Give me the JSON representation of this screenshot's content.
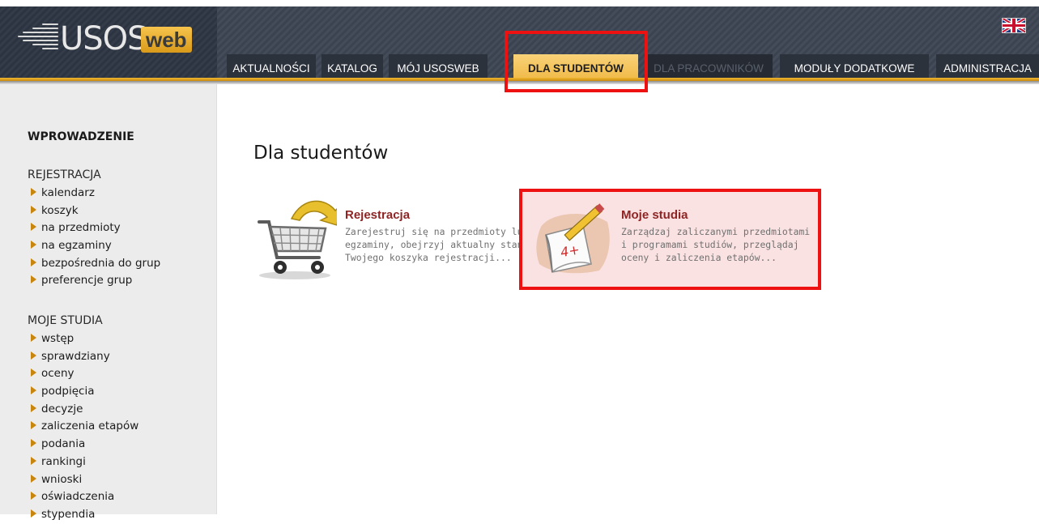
{
  "logo": {
    "main": "USOS",
    "accent": "web"
  },
  "nav": {
    "tabs": [
      {
        "label": "AKTUALNOŚCI"
      },
      {
        "label": "KATALOG"
      },
      {
        "label": "MÓJ USOSWEB"
      },
      {
        "label": "DLA STUDENTÓW",
        "active": true
      },
      {
        "label": "DLA PRACOWNIKÓW",
        "disabled": true
      },
      {
        "label": "MODUŁY DODATKOWE"
      },
      {
        "label": "ADMINISTRACJA"
      }
    ]
  },
  "language_flag": "uk-flag-icon",
  "sidebar": {
    "intro": "WPROWADZENIE",
    "sections": [
      {
        "heading": "REJESTRACJA",
        "items": [
          "kalendarz",
          "koszyk",
          "na przedmioty",
          "na egzaminy",
          "bezpośrednia do grup",
          "preferencje grup"
        ]
      },
      {
        "heading": "MOJE STUDIA",
        "items": [
          "wstęp",
          "sprawdziany",
          "oceny",
          "podpięcia",
          "decyzje",
          "zaliczenia etapów",
          "podania",
          "rankingi",
          "wnioski",
          "oświadczenia",
          "stypendia"
        ]
      }
    ]
  },
  "main": {
    "title": "Dla studentów",
    "cards": [
      {
        "title": "Rejestracja",
        "desc_lines": [
          "Zarejestruj się na przedmioty lub",
          "egzaminy, obejrzyj aktualny stan",
          "Twojego koszyka rejestracji..."
        ],
        "icon": "shopping-cart-icon"
      },
      {
        "title": "Moje studia",
        "desc_lines": [
          "Zarządzaj zaliczanymi przedmiotami",
          "i programami studiów, przeglądaj",
          "oceny i zaliczenia etapów..."
        ],
        "icon": "notebook-pencil-icon",
        "icon_text": "4+"
      }
    ]
  },
  "colors": {
    "accent": "#f0b531",
    "header_dark": "#2b3440",
    "card_title": "#8f2424",
    "highlight_box": "#ee1111",
    "bullet": "#c9860e"
  }
}
